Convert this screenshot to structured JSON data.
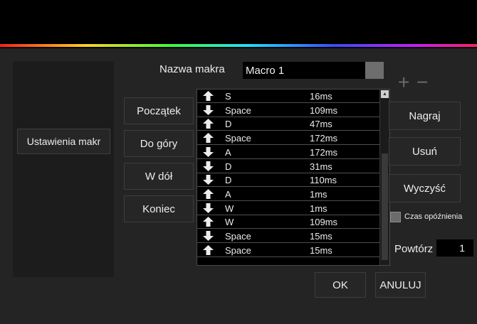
{
  "macro_name": {
    "label": "Nazwa makra",
    "value": "Macro 1"
  },
  "sidebar": {
    "settings_button": "Ustawienia makr"
  },
  "nav_buttons": {
    "start": "Początek",
    "up": "Do góry",
    "down": "W dół",
    "end": "Koniec"
  },
  "list_controls": {
    "add": "+",
    "remove": "−"
  },
  "macro_steps": [
    {
      "direction": "up",
      "key": "S",
      "delay": "16ms"
    },
    {
      "direction": "down",
      "key": "Space",
      "delay": "109ms"
    },
    {
      "direction": "up",
      "key": "D",
      "delay": "47ms"
    },
    {
      "direction": "up",
      "key": "Space",
      "delay": "172ms"
    },
    {
      "direction": "down",
      "key": "A",
      "delay": "172ms"
    },
    {
      "direction": "down",
      "key": "D",
      "delay": "31ms"
    },
    {
      "direction": "down",
      "key": "D",
      "delay": "110ms"
    },
    {
      "direction": "up",
      "key": "A",
      "delay": "1ms"
    },
    {
      "direction": "down",
      "key": "W",
      "delay": "1ms"
    },
    {
      "direction": "up",
      "key": "W",
      "delay": "109ms"
    },
    {
      "direction": "down",
      "key": "Space",
      "delay": "15ms"
    },
    {
      "direction": "up",
      "key": "Space",
      "delay": "15ms"
    }
  ],
  "right_buttons": {
    "record": "Nagraj",
    "delete": "Usuń",
    "clear": "Wyczyść"
  },
  "delay_option": {
    "label": "Czas opóźnienia",
    "checked": false
  },
  "repeat": {
    "label": "Powtórz",
    "value": "1"
  },
  "footer": {
    "ok": "OK",
    "cancel": "ANULUJ"
  },
  "colors": {
    "background": "#000000",
    "panel": "#242424",
    "arrow": "#ececec"
  }
}
